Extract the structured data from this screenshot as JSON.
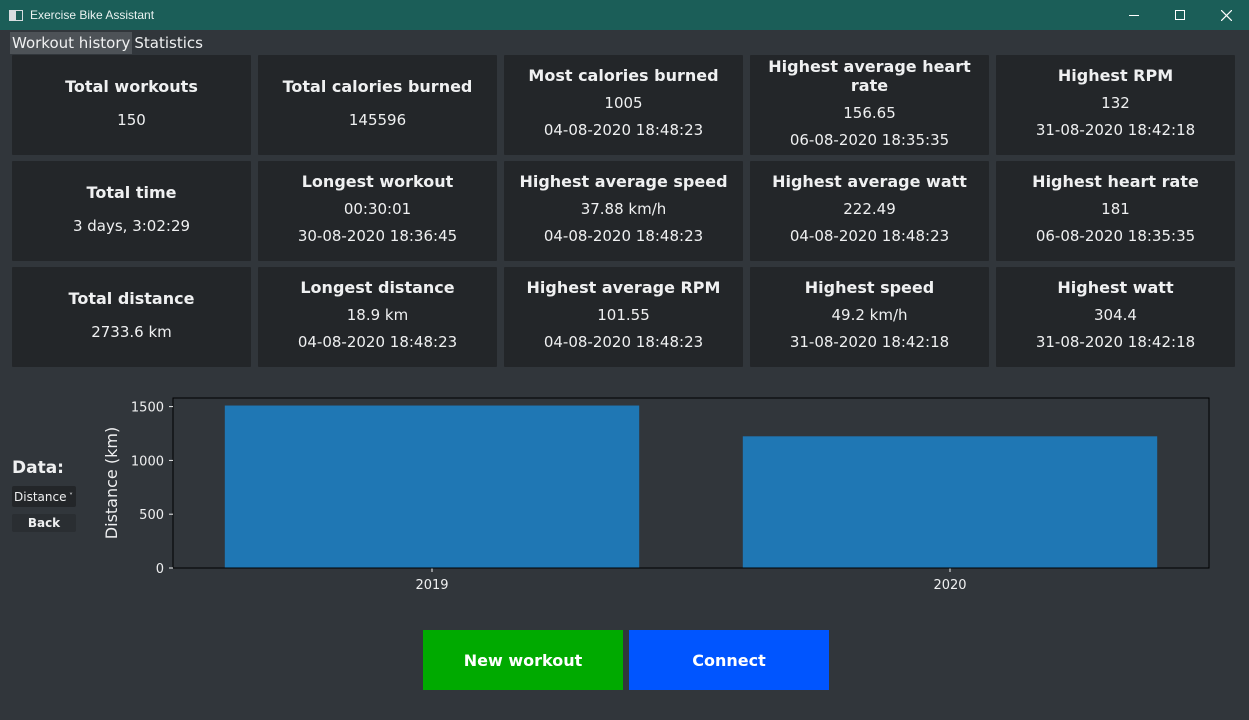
{
  "window": {
    "title": "Exercise Bike Assistant"
  },
  "menu": {
    "items": [
      "Workout history",
      "Statistics"
    ]
  },
  "stats": [
    {
      "name": "total-workouts",
      "label": "Total workouts",
      "value": "150",
      "date": ""
    },
    {
      "name": "total-calories",
      "label": "Total calories burned",
      "value": "145596",
      "date": ""
    },
    {
      "name": "most-calories",
      "label": "Most calories burned",
      "value": "1005",
      "date": "04-08-2020 18:48:23"
    },
    {
      "name": "highest-avg-heart-rate",
      "label": "Highest average heart rate",
      "value": "156.65",
      "date": "06-08-2020 18:35:35"
    },
    {
      "name": "highest-rpm",
      "label": "Highest RPM",
      "value": "132",
      "date": "31-08-2020 18:42:18"
    },
    {
      "name": "total-time",
      "label": "Total time",
      "value": "3 days, 3:02:29",
      "date": ""
    },
    {
      "name": "longest-workout",
      "label": "Longest workout",
      "value": "00:30:01",
      "date": "30-08-2020 18:36:45"
    },
    {
      "name": "highest-avg-speed",
      "label": "Highest average speed",
      "value": "37.88 km/h",
      "date": "04-08-2020 18:48:23"
    },
    {
      "name": "highest-avg-watt",
      "label": "Highest average watt",
      "value": "222.49",
      "date": "04-08-2020 18:48:23"
    },
    {
      "name": "highest-heart-rate",
      "label": "Highest heart rate",
      "value": "181",
      "date": "06-08-2020 18:35:35"
    },
    {
      "name": "total-distance",
      "label": "Total distance",
      "value": "2733.6 km",
      "date": ""
    },
    {
      "name": "longest-distance",
      "label": "Longest distance",
      "value": "18.9 km",
      "date": "04-08-2020 18:48:23"
    },
    {
      "name": "highest-avg-rpm",
      "label": "Highest average RPM",
      "value": "101.55",
      "date": "04-08-2020 18:48:23"
    },
    {
      "name": "highest-speed",
      "label": "Highest speed",
      "value": "49.2 km/h",
      "date": "31-08-2020 18:42:18"
    },
    {
      "name": "highest-watt",
      "label": "Highest watt",
      "value": "304.4",
      "date": "31-08-2020 18:42:18"
    }
  ],
  "controls": {
    "data_label": "Data:",
    "data_select_value": "Distance",
    "back_label": "Back"
  },
  "buttons": {
    "new_workout": "New workout",
    "connect": "Connect"
  },
  "colors": {
    "bar": "#1f77b4",
    "new_workout": "#00aa00",
    "connect": "#0055ff",
    "titlebar": "#1b5e58"
  },
  "chart_data": {
    "type": "bar",
    "categories": [
      "2019",
      "2020"
    ],
    "values": [
      1510,
      1224
    ],
    "ylabel": "Distance (km)",
    "ylim": [
      0,
      1580
    ],
    "yticks": [
      0,
      500,
      1000,
      1500
    ]
  }
}
